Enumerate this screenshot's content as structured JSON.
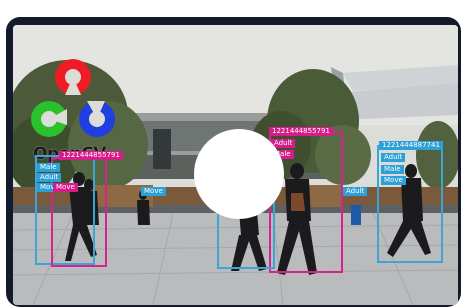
{
  "logo": {
    "text": "OpenCV"
  },
  "detections": [
    {
      "id": "1221444855791",
      "tags": [
        "Male",
        "Adult",
        "Move"
      ]
    },
    {
      "id": "1221444887741",
      "tags": [
        "Adult",
        "Male",
        "Move"
      ]
    },
    {
      "id": "1221444855791",
      "tags": [
        "Adult",
        "Male",
        "Move"
      ]
    }
  ],
  "colors": {
    "blue": "#2ea0d8",
    "pink": "#d81b8a",
    "frame": "#121a2b"
  }
}
